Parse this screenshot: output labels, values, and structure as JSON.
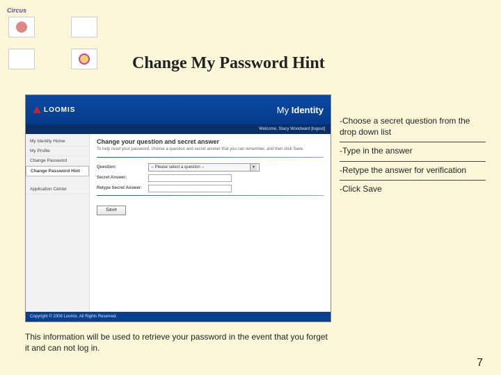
{
  "logo_tag": "Circus",
  "page_title": "Change My Password Hint",
  "screenshot": {
    "logo_text": "LOOMIS",
    "brand_prefix": "My",
    "brand_word": "Identity",
    "userbar": "Welcome, Stacy Woodward [logout]",
    "sidebar": {
      "items": [
        "My Identity Home",
        "My Profile",
        "Change Password",
        "Change Password Hint"
      ],
      "active_index": 3,
      "secondary": "Application Center"
    },
    "main": {
      "heading": "Change your question and secret answer",
      "desc": "To help reset your password, choose a question and secret answer that you can remember, and then click Save.",
      "fields": {
        "question_label": "Question:",
        "question_placeholder": "-- Please select a question --",
        "secret_label": "Secret Answer:",
        "retype_label": "Retype Secret Answer:"
      },
      "save_label": "Save"
    },
    "footer": "Copyright © 2008 Loomis. All Rights Reserved."
  },
  "instructions": [
    "-Choose a secret question from the drop down list",
    "-Type in the answer",
    "-Retype the answer for verification",
    "-Click Save"
  ],
  "footnote": "This information will be used to retrieve your password in the event that you forget it and can not log in.",
  "page_number": "7"
}
